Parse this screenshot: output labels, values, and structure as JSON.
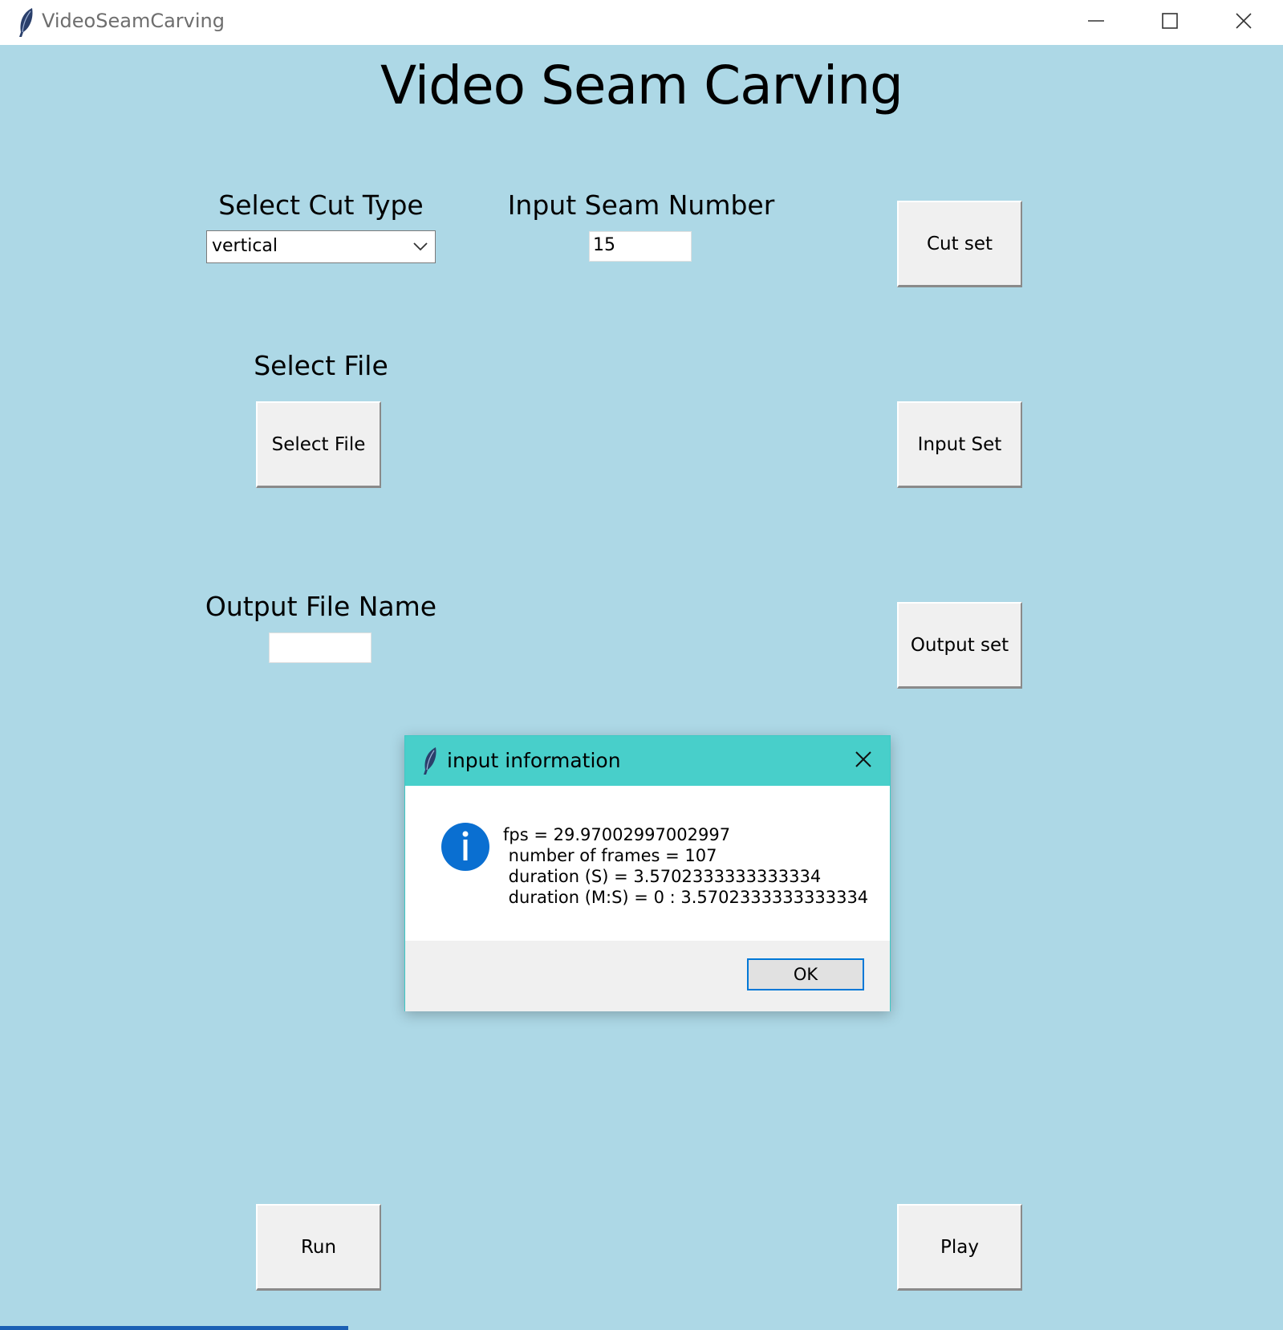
{
  "window": {
    "title": "VideoSeamCarving",
    "controls": [
      "minimize-icon",
      "maximize-icon",
      "close-icon"
    ]
  },
  "main": {
    "title": "Video Seam Carving",
    "cut_type": {
      "label": "Select Cut Type",
      "value": "vertical"
    },
    "seam_number": {
      "label": "Input Seam Number",
      "value": "15"
    },
    "select_file": {
      "label": "Select File",
      "button": "Select File"
    },
    "output_name": {
      "label": "Output File Name",
      "value": ""
    },
    "buttons": {
      "cut_set": "Cut set",
      "input_set": "Input Set",
      "output_set": "Output set",
      "run": "Run",
      "play": "Play"
    }
  },
  "dialog": {
    "title": "input information",
    "icon": "info-icon",
    "lines": [
      "fps = 29.97002997002997",
      " number of frames = 107",
      " duration (S) = 3.5702333333333334",
      " duration (M:S) = 0 : 3.5702333333333334"
    ],
    "ok": "OK"
  },
  "colors": {
    "background": "#add8e6",
    "dialog_titlebar": "#48cfca",
    "accent": "#0078d7"
  }
}
